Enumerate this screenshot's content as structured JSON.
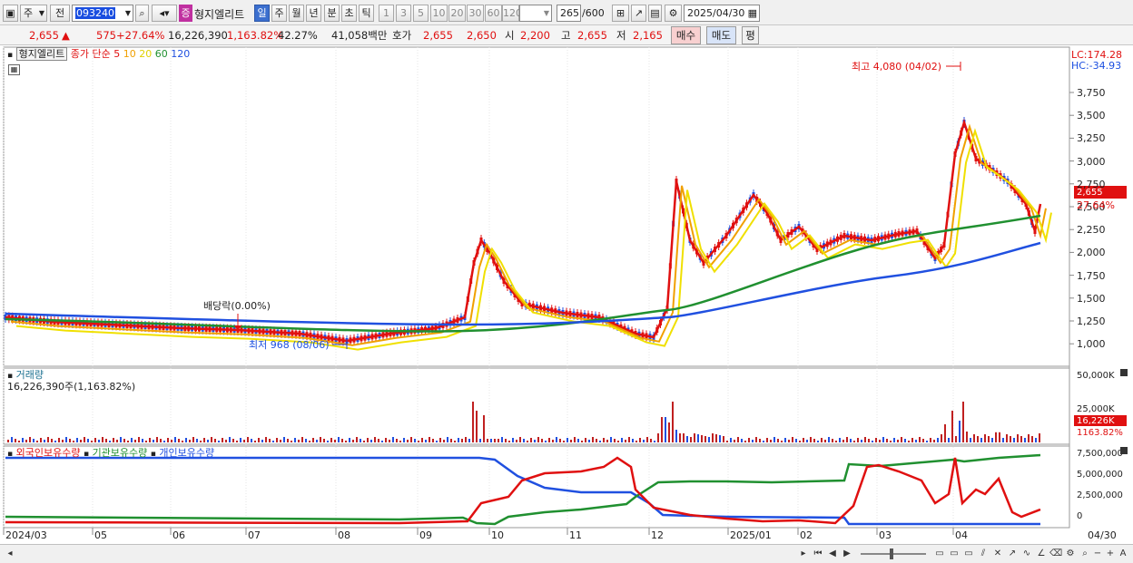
{
  "toolbar": {
    "market": "주",
    "prev_label": "전",
    "code": "093240",
    "stock_badge": "증",
    "stock_name": "형지엘리트",
    "periods": [
      "일",
      "주",
      "월",
      "년",
      "분",
      "초",
      "틱"
    ],
    "selected_period": "일",
    "intervals": [
      "1",
      "3",
      "5",
      "10",
      "20",
      "30",
      "60",
      "120"
    ],
    "count": "265",
    "count_total": "/600",
    "date": "2025/04/30"
  },
  "quote": {
    "price": "2,655",
    "change": "575",
    "change_pct": "+27.64%",
    "volume": "16,226,390",
    "volume_pct": "1,163.82%",
    "turnover_pct": "42.27%",
    "amount": "41,058백만",
    "hoga_label": "호가",
    "hoga_price": "2,655",
    "hoga_price2": "2,650",
    "open_label": "시",
    "open": "2,200",
    "high_label": "고",
    "high": "2,655",
    "low_label": "저",
    "low": "2,165",
    "buy_label": "매수",
    "sell_label": "매도",
    "eval_label": "평"
  },
  "chart": {
    "title_name": "형지엘리트",
    "ma_label": "종가 단순",
    "ma_periods": [
      "5",
      "10",
      "20",
      "60",
      "120"
    ],
    "ma_colors": [
      "#e01010",
      "#f0a000",
      "#f0e000",
      "#209030",
      "#2050e0"
    ],
    "lc": "LC:174.28",
    "hc": "HC:-34.93",
    "high_note": "최고 4,080 (04/02)",
    "low_note": "최저 968 (08/06)",
    "dividend_note": "배당락(0.00%)",
    "price_axis": [
      "3,750",
      "3,500",
      "3,250",
      "3,000",
      "2,750",
      "2,500",
      "2,250",
      "2,000",
      "1,750",
      "1,500",
      "1,250",
      "1,000"
    ],
    "current_price_tag": "2,655",
    "current_pct_tag": "27.64%",
    "volume_title": "거래량",
    "volume_value": "16,226,390주(1,163.82%)",
    "volume_axis": [
      "50,000K",
      "25,000K"
    ],
    "volume_tag": "16,226K",
    "volume_pct_tag": "1163.82%",
    "holding_labels": [
      "외국인보유수량",
      "기관보유수량",
      "개인보유수량"
    ],
    "holding_colors": [
      "#e01010",
      "#209030",
      "#2050e0"
    ],
    "holding_axis": [
      "7,500,000",
      "5,000,000",
      "2,500,000",
      "0"
    ],
    "date_axis": [
      "2024/03",
      "05",
      "06",
      "07",
      "08",
      "09",
      "10",
      "11",
      "12",
      "2025/01",
      "02",
      "03",
      "04",
      "04/30"
    ]
  }
}
